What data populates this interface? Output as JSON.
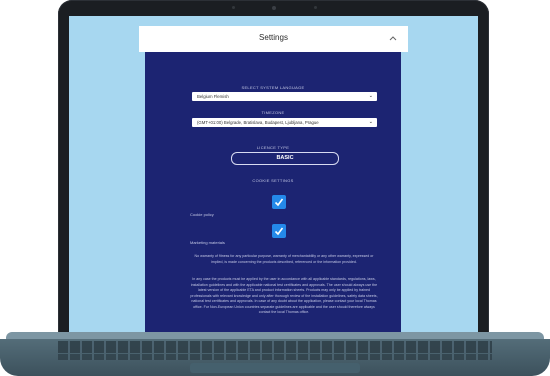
{
  "app": {
    "header_title": "Settings",
    "labels": {
      "language": "SELECT SYSTEM LANGUAGE",
      "timezone": "TIMEZONE",
      "licence_type": "LICENCE TYPE",
      "cookie_settings": "COOKIE SETTINGS"
    },
    "language_value": "Belgium Flemish",
    "timezone_value": "(GMT+01:00) Belgrade, Bratislava, Budapest, Ljubljana, Prague",
    "licence_button": "BASIC",
    "cookies": [
      {
        "label": "Cookie policy",
        "checked": true
      },
      {
        "label": "Marketing materials",
        "checked": true
      }
    ],
    "paragraph1": "No warranty of fitness for any particular purpose, warranty of merchantability or any other warranty, expressed or implied, is made concerning the products described, referenced or the information provided.",
    "paragraph2": "In any case the products must be applied by the user in accordance with all applicable standards, regulations, laws, installation guidelines and with the applicable national test certificates and approvals. The user should always use the latest version of the applicable ETA and product information sheets. Products may only be applied by trained professionals with relevant knowledge and only after thorough review of the installation guidelines, safety data sheets, national test certificates and approvals. In case of any doubt about the application, please contact your local Thomas office. For Non-European Union countries separate guidelines are applicable and the user should therefore always contact the local Thomas office."
  },
  "colors": {
    "panel": "#1c2472",
    "checkbox": "#2489ea",
    "screen_bg": "#a7d7f0"
  }
}
